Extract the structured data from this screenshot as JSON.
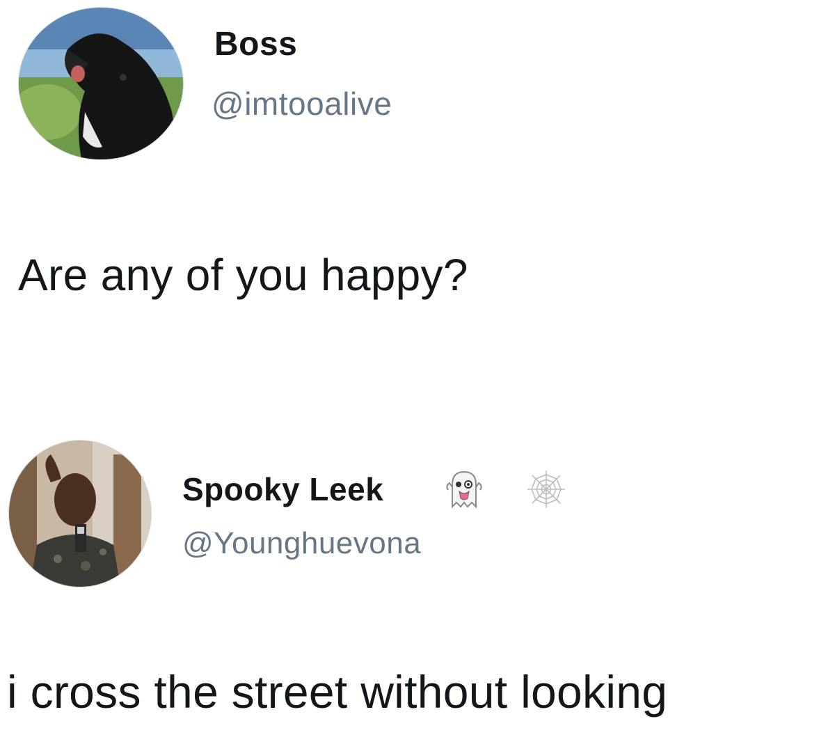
{
  "tweets": [
    {
      "display_name": "Boss",
      "handle": "@imtooalive",
      "text": "Are any of you happy?",
      "avatar": "dog-avatar"
    },
    {
      "display_name": "Spooky Leek",
      "handle": "@Younghuevona",
      "text": "i cross the street without looking",
      "avatar": "person-selfie-avatar",
      "name_emojis": [
        "ghost-emoji",
        "spider-web-emoji"
      ]
    }
  ],
  "colors": {
    "background": "#ffffff",
    "text": "#14171a",
    "handle": "#657786"
  }
}
